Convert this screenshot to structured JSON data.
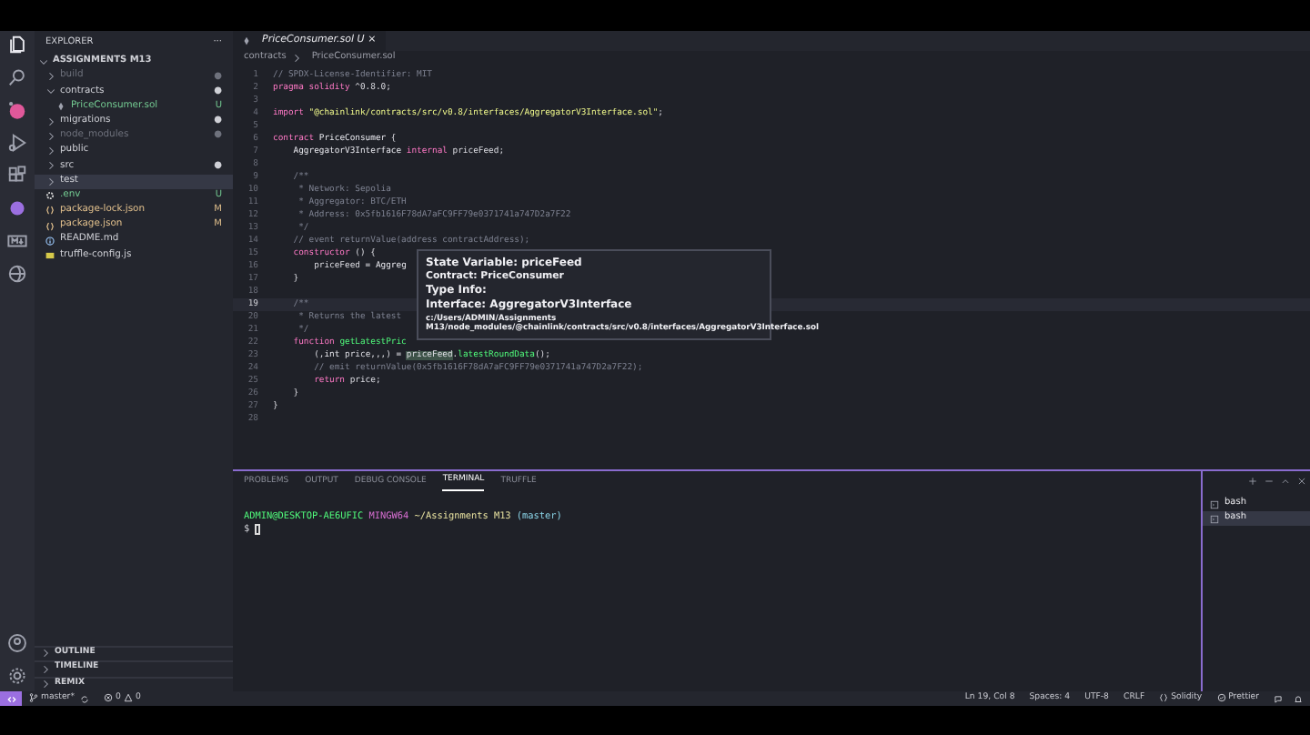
{
  "explorer": {
    "title": "EXPLORER",
    "more": "···",
    "folder": "ASSIGNMENTS M13",
    "items": [
      {
        "label": "build",
        "kind": "folder",
        "expanded": false,
        "selected": false,
        "color": "#6e717c",
        "badge": "●"
      },
      {
        "label": "contracts",
        "kind": "folder",
        "expanded": true,
        "selected": false,
        "color": "#cfd0d6",
        "badge": "●",
        "children": [
          {
            "label": "PriceConsumer.sol",
            "kind": "solidity",
            "selected": false,
            "color": "#73c991",
            "badge": "U"
          }
        ]
      },
      {
        "label": "migrations",
        "kind": "folder",
        "expanded": false,
        "selected": false,
        "color": "#cfd0d6",
        "badge": "●"
      },
      {
        "label": "node_modules",
        "kind": "folder",
        "expanded": false,
        "selected": false,
        "color": "#6e717c",
        "badge": "●"
      },
      {
        "label": "public",
        "kind": "folder",
        "expanded": false,
        "selected": false,
        "color": "#cfd0d6"
      },
      {
        "label": "src",
        "kind": "folder",
        "expanded": false,
        "selected": false,
        "color": "#cfd0d6",
        "badge": "●"
      },
      {
        "label": "test",
        "kind": "folder",
        "expanded": false,
        "selected": true,
        "color": "#cfd0d6"
      },
      {
        "label": ".env",
        "kind": "env",
        "selected": false,
        "color": "#73c991",
        "badge": "U"
      },
      {
        "label": "package-lock.json",
        "kind": "json",
        "selected": false,
        "color": "#e2c08d",
        "badge": "M"
      },
      {
        "label": "package.json",
        "kind": "json",
        "selected": false,
        "color": "#e2c08d",
        "badge": "M"
      },
      {
        "label": "README.md",
        "kind": "info",
        "selected": false,
        "color": "#cfd0d6"
      },
      {
        "label": "truffle-config.js",
        "kind": "javascript",
        "selected": false,
        "color": "#cfd0d6"
      }
    ],
    "sections": [
      "OUTLINE",
      "TIMELINE",
      "REMIX"
    ]
  },
  "editor": {
    "tab": {
      "label": "PriceConsumer.sol",
      "badge": "U",
      "close": "×"
    },
    "breadcrumbs": [
      "contracts",
      "PriceConsumer.sol"
    ],
    "lines": [
      {
        "number": "1",
        "current": false,
        "tokens": [
          {
            "kind": "comment",
            "text": "// SPDX-License-Identifier: MIT"
          }
        ]
      },
      {
        "number": "2",
        "current": false,
        "tokens": [
          {
            "kind": "keyword",
            "text": "pragma solidity"
          },
          {
            "kind": "plain",
            "text": " ^0.8.0;"
          }
        ]
      },
      {
        "number": "3",
        "current": false
      },
      {
        "number": "4",
        "current": false,
        "tokens": [
          {
            "kind": "keyword",
            "text": "import"
          },
          {
            "kind": "string",
            "text": " \"@chainlink/contracts/src/v0.8/interfaces/AggregatorV3Interface.sol\""
          },
          {
            "kind": "plain",
            "text": ";"
          }
        ]
      },
      {
        "number": "5",
        "current": false
      },
      {
        "number": "6",
        "current": false,
        "tokens": [
          {
            "kind": "keyword",
            "text": "contract"
          },
          {
            "kind": "type",
            "text": " PriceConsumer"
          },
          {
            "kind": "plain",
            "text": " {"
          }
        ]
      },
      {
        "number": "7",
        "current": false,
        "tokens": [
          {
            "kind": "type",
            "text": "    AggregatorV3Interface"
          },
          {
            "kind": "keyword",
            "text": " internal"
          },
          {
            "kind": "plain",
            "text": " priceFeed;"
          }
        ]
      },
      {
        "number": "8",
        "current": false
      },
      {
        "number": "9",
        "current": false,
        "tokens": [
          {
            "kind": "comment",
            "text": "    /**"
          }
        ]
      },
      {
        "number": "10",
        "current": false,
        "tokens": [
          {
            "kind": "comment",
            "text": "     * Network: Sepolia"
          }
        ]
      },
      {
        "number": "11",
        "current": false,
        "tokens": [
          {
            "kind": "comment",
            "text": "     * Aggregator: BTC/ETH"
          }
        ]
      },
      {
        "number": "12",
        "current": false,
        "tokens": [
          {
            "kind": "comment",
            "text": "     * Address: 0x5fb1616F78dA7aFC9FF79e0371741a747D2a7F22"
          }
        ]
      },
      {
        "number": "13",
        "current": false,
        "tokens": [
          {
            "kind": "comment",
            "text": "     */"
          }
        ]
      },
      {
        "number": "14",
        "current": false,
        "tokens": [
          {
            "kind": "comment",
            "text": "    // event returnValue(address contractAddress);"
          }
        ]
      },
      {
        "number": "15",
        "current": false,
        "tokens": [
          {
            "kind": "keyword",
            "text": "    constructor"
          },
          {
            "kind": "plain",
            "text": " () {"
          }
        ]
      },
      {
        "number": "16",
        "current": false,
        "tokens": [
          {
            "kind": "plain",
            "text": "        priceFeed = "
          },
          {
            "kind": "type",
            "text": "Aggreg"
          }
        ]
      },
      {
        "number": "17",
        "current": false,
        "tokens": [
          {
            "kind": "plain",
            "text": "    }"
          }
        ]
      },
      {
        "number": "18",
        "current": false
      },
      {
        "number": "19",
        "current": true,
        "tokens": [
          {
            "kind": "comment",
            "text": "    /**"
          }
        ]
      },
      {
        "number": "20",
        "current": false,
        "tokens": [
          {
            "kind": "comment",
            "text": "     * Returns the latest"
          }
        ]
      },
      {
        "number": "21",
        "current": false,
        "tokens": [
          {
            "kind": "comment",
            "text": "     */"
          }
        ]
      },
      {
        "number": "22",
        "current": false,
        "tokens": [
          {
            "kind": "keyword",
            "text": "    function"
          },
          {
            "kind": "func",
            "text": " getLatestPric"
          }
        ]
      },
      {
        "number": "23",
        "current": false,
        "tokens": [
          {
            "kind": "plain",
            "text": "        (,"
          },
          {
            "kind": "type",
            "text": "int"
          },
          {
            "kind": "plain",
            "text": " price,,,) = "
          },
          {
            "kind": "hover",
            "text": "priceFeed"
          },
          {
            "kind": "plain",
            "text": "."
          },
          {
            "kind": "func",
            "text": "latestRoundData"
          },
          {
            "kind": "plain",
            "text": "();"
          }
        ]
      },
      {
        "number": "24",
        "current": false,
        "tokens": [
          {
            "kind": "comment",
            "text": "        // emit returnValue(0x5fb1616F78dA7aFC9FF79e0371741a747D2a7F22);"
          }
        ]
      },
      {
        "number": "25",
        "current": false,
        "tokens": [
          {
            "kind": "keyword",
            "text": "        return"
          },
          {
            "kind": "plain",
            "text": " price;"
          }
        ]
      },
      {
        "number": "26",
        "current": false,
        "tokens": [
          {
            "kind": "plain",
            "text": "    }"
          }
        ]
      },
      {
        "number": "27",
        "current": false,
        "tokens": [
          {
            "kind": "plain",
            "text": "}"
          }
        ]
      },
      {
        "number": "28",
        "current": false
      }
    ],
    "hover": {
      "title": "State Variable: priceFeed",
      "contract": "Contract: PriceConsumer",
      "type_info": "Type Info:",
      "interface": "Interface: AggregatorV3Interface",
      "path": "c:/Users/ADMIN/Assignments M13/node_modules/@chainlink/contracts/src/v0.8/interfaces/AggregatorV3Interface.sol"
    }
  },
  "panel": {
    "tabs": [
      {
        "label": "PROBLEMS",
        "selected": false
      },
      {
        "label": "OUTPUT",
        "selected": false
      },
      {
        "label": "DEBUG CONSOLE",
        "selected": false
      },
      {
        "label": "TERMINAL",
        "selected": true
      },
      {
        "label": "TRUFFLE",
        "selected": false
      }
    ],
    "terminal": {
      "user": "ADMIN@DESKTOP-AE6UFIC",
      "shell": "MINGW64",
      "path": "~/Assignments M13",
      "branch": "(master)",
      "prompt": "$"
    },
    "terminals": [
      {
        "label": "bash",
        "selected": false
      },
      {
        "label": "bash",
        "selected": true
      }
    ]
  },
  "status_bar": {
    "branch": "master*",
    "errors": "0",
    "warnings": "0",
    "right": [
      "Ln 19, Col 8",
      "Spaces: 4",
      "UTF-8",
      "CRLF",
      "Solidity",
      "Prettier"
    ]
  }
}
